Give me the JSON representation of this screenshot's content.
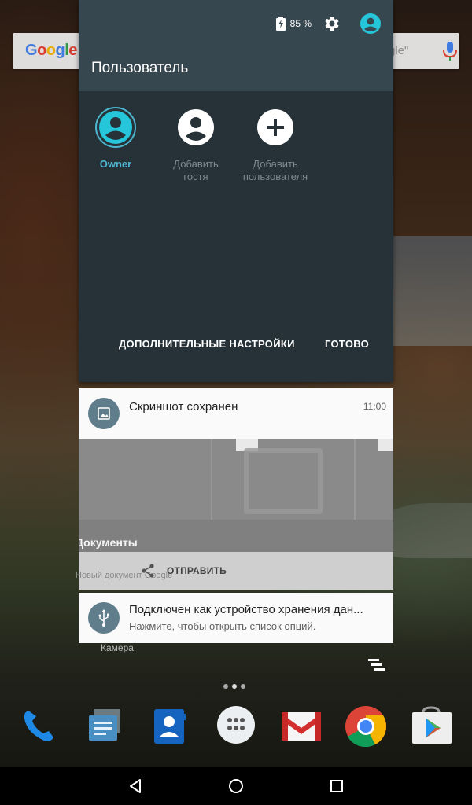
{
  "status": {
    "battery_percent": "85 %",
    "battery_icon": "battery-charging-icon",
    "settings_icon": "gear-icon",
    "user_icon": "account-circle-icon"
  },
  "search_bar": {
    "logo": "Google",
    "hint_fragment": "gle\"",
    "mic_icon": "mic-icon"
  },
  "user_panel": {
    "title": "Пользователь",
    "users": [
      {
        "label": "Owner",
        "icon": "account-circle-icon",
        "active": true
      },
      {
        "label_line1": "Добавить",
        "label_line2": "гостя",
        "icon": "account-circle-icon"
      },
      {
        "label_line1": "Добавить",
        "label_line2": "пользователя",
        "icon": "add-circle-icon"
      }
    ],
    "more_settings": "ДОПОЛНИТЕЛЬНЫЕ НАСТРОЙКИ",
    "done": "ГОТОВО"
  },
  "notifications": {
    "screenshot": {
      "title": "Скриншот сохранен",
      "time": "11:00",
      "icon": "image-icon",
      "preview_label": "Документы",
      "ghost_text": "Новый документ Google",
      "action": "ОТПРАВИТЬ",
      "action_icon": "share-icon"
    },
    "usb": {
      "title": "Подключен как устройство хранения дан...",
      "subtitle": "Нажмите, чтобы открыть список опций.",
      "icon": "usb-icon"
    }
  },
  "home": {
    "camera_label": "Камера",
    "clear_all_icon": "clear-all-icon",
    "dock_apps": [
      "phone-icon",
      "messages-icon",
      "contacts-icon",
      "app-drawer-icon",
      "gmail-icon",
      "chrome-icon",
      "play-store-icon"
    ]
  },
  "colors": {
    "panel_bg": "#263238",
    "panel_header": "#37474f",
    "accent": "#4db6cf",
    "notif_icon_bg": "#607d8b"
  }
}
